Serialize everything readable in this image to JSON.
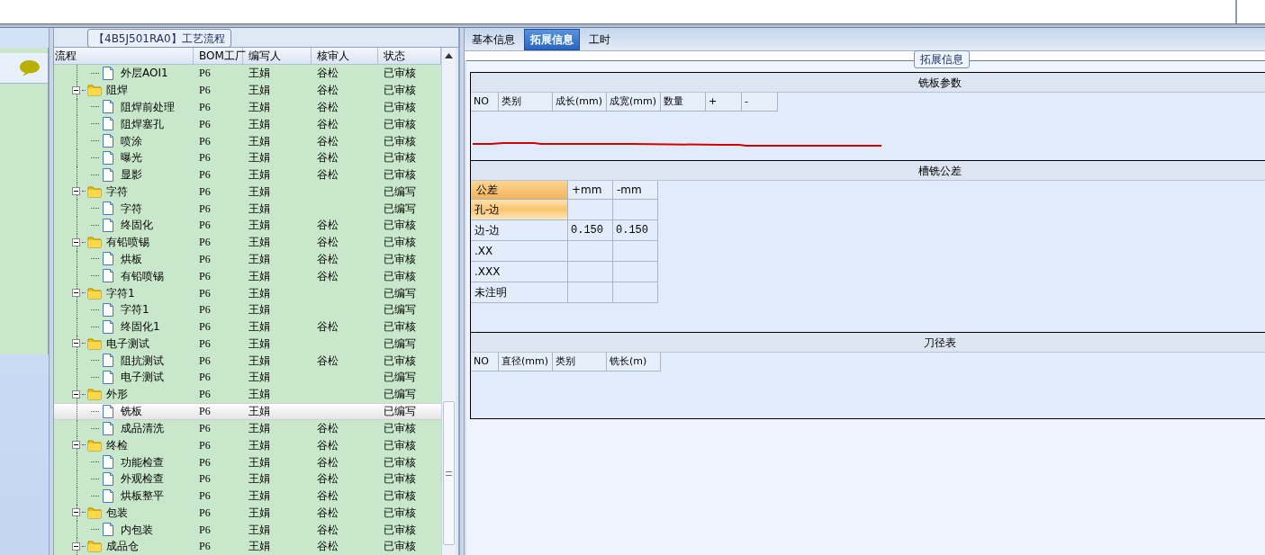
{
  "tree_panel": {
    "title": "【4B5J501RA0】工艺流程",
    "columns": [
      "流程",
      "BOM工厂",
      "编写人",
      "核审人",
      "状态"
    ],
    "rows": [
      {
        "kind": "file",
        "name": "外层AOI1",
        "bom": "P6",
        "writer": "王娟",
        "reviewer": "谷松",
        "status": "已审核",
        "selected": false
      },
      {
        "kind": "folder",
        "name": "阻焊",
        "bom": "P6",
        "writer": "王娟",
        "reviewer": "谷松",
        "status": "已审核",
        "selected": false,
        "expanded": true,
        "children": [
          {
            "kind": "file",
            "name": "阻焊前处理",
            "bom": "P6",
            "writer": "王娟",
            "reviewer": "谷松",
            "status": "已审核",
            "selected": false
          },
          {
            "kind": "file",
            "name": "阻焊塞孔",
            "bom": "P6",
            "writer": "王娟",
            "reviewer": "谷松",
            "status": "已审核",
            "selected": false
          },
          {
            "kind": "file",
            "name": "喷涂",
            "bom": "P6",
            "writer": "王娟",
            "reviewer": "谷松",
            "status": "已审核",
            "selected": false
          },
          {
            "kind": "file",
            "name": "曝光",
            "bom": "P6",
            "writer": "王娟",
            "reviewer": "谷松",
            "status": "已审核",
            "selected": false
          },
          {
            "kind": "file",
            "name": "显影",
            "bom": "P6",
            "writer": "王娟",
            "reviewer": "谷松",
            "status": "已审核",
            "selected": false
          }
        ]
      },
      {
        "kind": "folder",
        "name": "字符",
        "bom": "P6",
        "writer": "王娟",
        "status": "已编写",
        "selected": false,
        "expanded": true,
        "children": [
          {
            "kind": "file",
            "name": "字符",
            "bom": "P6",
            "writer": "王娟",
            "status": "已编写",
            "selected": false
          },
          {
            "kind": "file",
            "name": "终固化",
            "bom": "P6",
            "writer": "王娟",
            "reviewer": "谷松",
            "status": "已审核",
            "selected": false
          }
        ]
      },
      {
        "kind": "folder",
        "name": "有铅喷锡",
        "bom": "P6",
        "writer": "王娟",
        "reviewer": "谷松",
        "status": "已审核",
        "selected": false,
        "expanded": true,
        "children": [
          {
            "kind": "file",
            "name": "烘板",
            "bom": "P6",
            "writer": "王娟",
            "reviewer": "谷松",
            "status": "已审核",
            "selected": false
          },
          {
            "kind": "file",
            "name": "有铅喷锡",
            "bom": "P6",
            "writer": "王娟",
            "reviewer": "谷松",
            "status": "已审核",
            "selected": false
          }
        ]
      },
      {
        "kind": "folder",
        "name": "字符1",
        "bom": "P6",
        "writer": "王娟",
        "status": "已编写",
        "selected": false,
        "expanded": true,
        "children": [
          {
            "kind": "file",
            "name": "字符1",
            "bom": "P6",
            "writer": "王娟",
            "status": "已编写",
            "selected": false
          },
          {
            "kind": "file",
            "name": "终固化1",
            "bom": "P6",
            "writer": "王娟",
            "reviewer": "谷松",
            "status": "已审核",
            "selected": false
          }
        ]
      },
      {
        "kind": "folder",
        "name": "电子测试",
        "bom": "P6",
        "writer": "王娟",
        "status": "已编写",
        "selected": false,
        "expanded": true,
        "children": [
          {
            "kind": "file",
            "name": "阻抗测试",
            "bom": "P6",
            "writer": "王娟",
            "reviewer": "谷松",
            "status": "已审核",
            "selected": false
          },
          {
            "kind": "file",
            "name": "电子测试",
            "bom": "P6",
            "writer": "王娟",
            "status": "已编写",
            "selected": false
          }
        ]
      },
      {
        "kind": "folder",
        "name": "外形",
        "bom": "P6",
        "writer": "王娟",
        "status": "已编写",
        "selected": false,
        "expanded": true,
        "children": [
          {
            "kind": "file",
            "name": "铣板",
            "bom": "P6",
            "writer": "王娟",
            "status": "已编写",
            "selected": true
          },
          {
            "kind": "file",
            "name": "成品清洗",
            "bom": "P6",
            "writer": "王娟",
            "reviewer": "谷松",
            "status": "已审核",
            "selected": false
          }
        ]
      },
      {
        "kind": "folder",
        "name": "终检",
        "bom": "P6",
        "writer": "王娟",
        "reviewer": "谷松",
        "status": "已审核",
        "selected": false,
        "expanded": true,
        "children": [
          {
            "kind": "file",
            "name": "功能检查",
            "bom": "P6",
            "writer": "王娟",
            "reviewer": "谷松",
            "status": "已审核",
            "selected": false
          },
          {
            "kind": "file",
            "name": "外观检查",
            "bom": "P6",
            "writer": "王娟",
            "reviewer": "谷松",
            "status": "已审核",
            "selected": false
          },
          {
            "kind": "file",
            "name": "烘板整平",
            "bom": "P6",
            "writer": "王娟",
            "reviewer": "谷松",
            "status": "已审核",
            "selected": false
          }
        ]
      },
      {
        "kind": "folder",
        "name": "包装",
        "bom": "P6",
        "writer": "王娟",
        "reviewer": "谷松",
        "status": "已审核",
        "selected": false,
        "expanded": true,
        "children": [
          {
            "kind": "file",
            "name": "内包装",
            "bom": "P6",
            "writer": "王娟",
            "reviewer": "谷松",
            "status": "已审核",
            "selected": false
          }
        ]
      },
      {
        "kind": "folder",
        "name": "成品仓",
        "bom": "P6",
        "writer": "王娟",
        "reviewer": "谷松",
        "status": "已审核",
        "selected": false,
        "expanded": true
      }
    ]
  },
  "detail_panel": {
    "tabs": [
      {
        "label": "基本信息",
        "selected": false
      },
      {
        "label": "拓展信息",
        "selected": true
      },
      {
        "label": "工时",
        "selected": false
      }
    ],
    "group_title": "拓展信息",
    "sections": [
      {
        "kind": "grid",
        "title": "铣板参数",
        "columns": [
          "NO",
          "类别",
          "成长(mm)",
          "成宽(mm)",
          "数量",
          "+",
          "-"
        ]
      },
      {
        "kind": "tolerance",
        "title": "槽铣公差",
        "columns": [
          "公差",
          "+mm",
          "-mm"
        ],
        "rows": [
          {
            "label": "孔-边",
            "selected": true
          },
          {
            "label": "边-边",
            "plus": "0.150",
            "minus": "0.150",
            "selected": false
          },
          {
            "label": ".XX",
            "selected": false
          },
          {
            "label": ".XXX",
            "selected": false
          },
          {
            "label": "未注明",
            "selected": false
          }
        ]
      },
      {
        "kind": "grid",
        "title": "刀径表",
        "columns": [
          "NO",
          "直径(mm)",
          "类别",
          "铣长(m)"
        ]
      }
    ]
  }
}
